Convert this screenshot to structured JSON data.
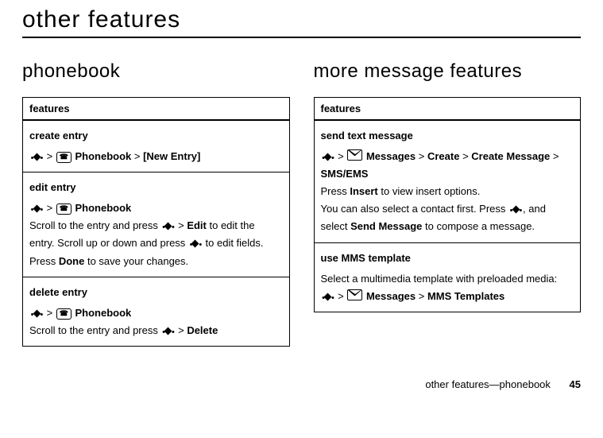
{
  "page": {
    "title": "other features",
    "footer_text": "other features—phonebook",
    "page_number": "45"
  },
  "gt": ">",
  "left": {
    "heading": "phonebook",
    "table_header": "features",
    "rows": {
      "create": {
        "title": "create entry",
        "gt1": ">",
        "app": "Phonebook",
        "gt2": ">",
        "tail": "[New Entry]"
      },
      "edit": {
        "title": "edit entry",
        "gt1": ">",
        "app": "Phonebook",
        "body_a": "Scroll to the entry and press ",
        "gt2": " > ",
        "edit": "Edit",
        "body_b": " to edit the entry. Scroll up or down and press ",
        "body_c": " to edit fields. Press ",
        "done": "Done",
        "body_d": " to save your changes."
      },
      "delete": {
        "title": "delete entry",
        "gt1": ">",
        "app": "Phonebook",
        "body_a": "Scroll to the entry and press ",
        "gt2": " > ",
        "del": "Delete"
      }
    }
  },
  "right": {
    "heading": "more message features",
    "table_header": "features",
    "rows": {
      "send": {
        "title": "send text message",
        "gt1": ">",
        "app": "Messages",
        "gt2": ">",
        "create": "Create",
        "gt3": ">",
        "createmsg": "Create Message",
        "gt4": ">",
        "tail": "SMS/EMS",
        "body_a": "Press ",
        "insert": "Insert",
        "body_b": " to view insert options.",
        "body_c": "You can also select a contact first. Press ",
        "body_d": ", and select ",
        "sendmsg": "Send Message",
        "body_e": " to compose a message."
      },
      "tmpl": {
        "title": "use MMS template",
        "body_a": "Select a multimedia template with preloaded media:",
        "gt1": ">",
        "app": "Messages",
        "gt2": ">",
        "tail": "MMS Templates"
      }
    }
  }
}
